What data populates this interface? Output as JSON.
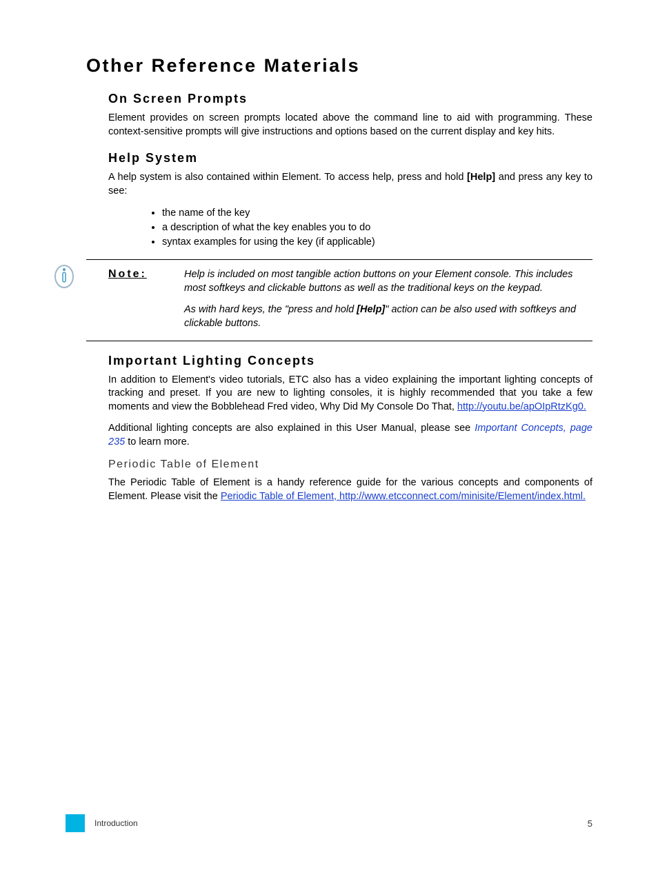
{
  "heading": "Other Reference Materials",
  "sections": {
    "prompts": {
      "title": "On Screen Prompts",
      "para": "Element provides on screen prompts located above the command line to aid with programming. These context-sensitive prompts will give instructions and options based on the current display and key hits."
    },
    "help": {
      "title": "Help System",
      "para_a": "A help system is also contained within Element. To access help, press and hold ",
      "help_key": "[Help]",
      "para_b": " and press any key to see:",
      "bullets": [
        "the name of the key",
        "a description of what the key enables you to do",
        "syntax examples for using the key (if applicable)"
      ]
    },
    "note": {
      "label": "Note:",
      "p1": "Help is included on most tangible action buttons on your Element console. This includes most softkeys and clickable buttons as well as the traditional keys on the keypad.",
      "p2a": "As with hard keys, the \"press and hold ",
      "p2_key": "[Help]",
      "p2b": "\" action can be also used with softkeys and clickable buttons."
    },
    "concepts": {
      "title": "Important Lighting Concepts",
      "p1a": "In addition to Element's video tutorials, ETC also has a video explaining the important lighting concepts of tracking and preset. If you are new to lighting consoles, it is highly recommended that you take a few moments and view the Bobblehead Fred video, Why Did My Console Do That, ",
      "link1": "http://youtu.be/apOIpRtzKg0.",
      "p2a": "Additional lighting concepts are also explained in this User Manual, please see ",
      "xref": "Important Concepts, page 235",
      "p2b": " to learn more."
    },
    "periodic": {
      "title": "Periodic Table of Element",
      "p1a": "The Periodic Table of Element is a handy reference guide for the various concepts and components of Element. Please visit the ",
      "link": "Periodic Table of Element, http://www.etcconnect.com/minisite/Element/index.html."
    }
  },
  "footer": {
    "section": "Introduction",
    "page": "5"
  }
}
